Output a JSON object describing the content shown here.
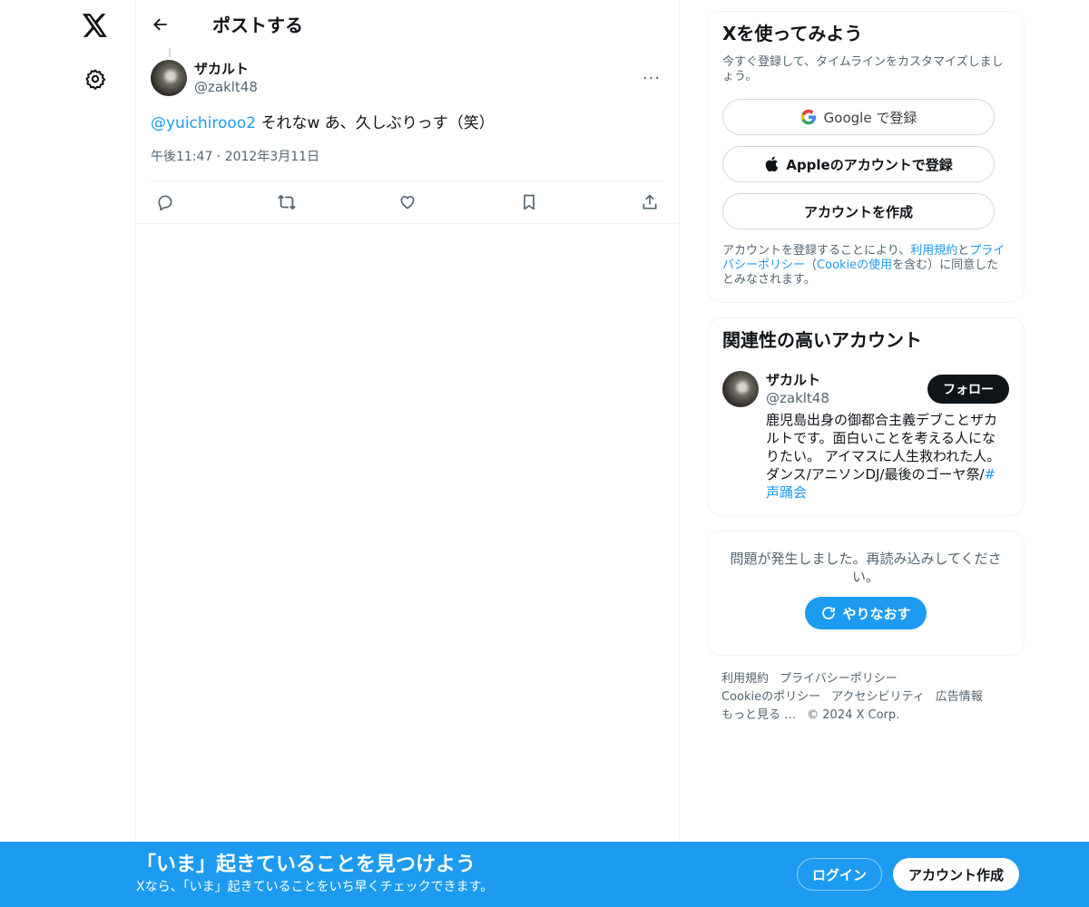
{
  "nav": {
    "logo_icon": "x-logo-icon",
    "settings_icon": "gear-icon"
  },
  "header": {
    "title": "ポストする"
  },
  "post": {
    "display_name": "ザカルト",
    "handle": "@zaklt48",
    "mention": "@yuichirooo2",
    "text": " それなw あ、久しぶりっす（笑）",
    "timestamp": "午後11:47 · 2012年3月11日",
    "more_label": "···"
  },
  "signup": {
    "title": "Xを使ってみよう",
    "subtitle": "今すぐ登録して、タイムラインをカスタマイズしましょう。",
    "google_label": "Google で登録",
    "apple_label": "Appleのアカウントで登録",
    "create_label": "アカウントを作成",
    "legal_prefix": "アカウントを登録することにより、",
    "legal_terms": "利用規約",
    "legal_and": "と",
    "legal_privacy": "プライバシーポリシー",
    "legal_paren_open": "（",
    "legal_cookie": "Cookieの使用",
    "legal_suffix": "を含む）に同意したとみなされます。"
  },
  "related": {
    "title": "関連性の高いアカウント",
    "display_name": "ザカルト",
    "handle": "@zaklt48",
    "follow_label": "フォロー",
    "bio": "鹿児島出身の御都合主義デブことザカルトです。面白いことを考える人になりたい。 アイマスに人生救われた人。ダンス/アニソンDJ/最後のゴーヤ祭/",
    "bio_hashtag": "#声踊会"
  },
  "error": {
    "message": "問題が発生しました。再読み込みしてください。",
    "retry_label": "やりなおす"
  },
  "footer": {
    "row1": [
      "利用規約",
      "プライバシーポリシー"
    ],
    "row2": [
      "Cookieのポリシー",
      "アクセシビリティ",
      "広告情報"
    ],
    "more": "もっと見る …",
    "copyright": "© 2024 X Corp."
  },
  "bottom_bar": {
    "title": "「いま」起きていることを見つけよう",
    "subtitle": "Xなら、「いま」起きていることをいち早くチェックできます。",
    "login_label": "ログイン",
    "signup_label": "アカウント作成"
  },
  "colors": {
    "accent": "#1d9bf0",
    "text": "#0f1419",
    "muted": "#536471",
    "border": "#eff3f4"
  }
}
